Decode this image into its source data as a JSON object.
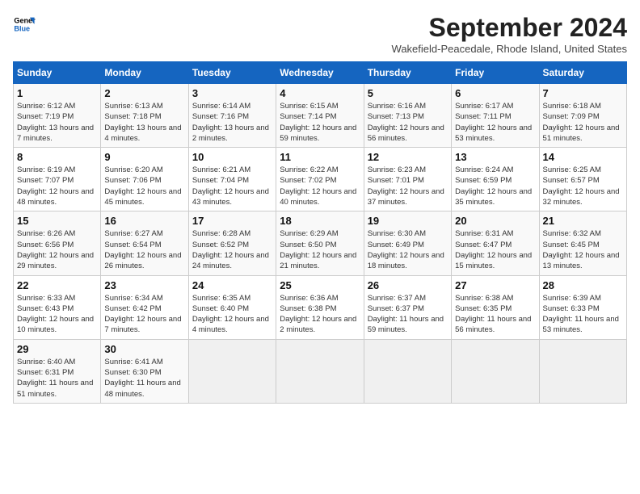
{
  "logo": {
    "line1": "General",
    "line2": "Blue"
  },
  "title": "September 2024",
  "subtitle": "Wakefield-Peacedale, Rhode Island, United States",
  "days_of_week": [
    "Sunday",
    "Monday",
    "Tuesday",
    "Wednesday",
    "Thursday",
    "Friday",
    "Saturday"
  ],
  "weeks": [
    [
      {
        "day": "1",
        "info": "Sunrise: 6:12 AM\nSunset: 7:19 PM\nDaylight: 13 hours\nand 7 minutes."
      },
      {
        "day": "2",
        "info": "Sunrise: 6:13 AM\nSunset: 7:18 PM\nDaylight: 13 hours\nand 4 minutes."
      },
      {
        "day": "3",
        "info": "Sunrise: 6:14 AM\nSunset: 7:16 PM\nDaylight: 13 hours\nand 2 minutes."
      },
      {
        "day": "4",
        "info": "Sunrise: 6:15 AM\nSunset: 7:14 PM\nDaylight: 12 hours\nand 59 minutes."
      },
      {
        "day": "5",
        "info": "Sunrise: 6:16 AM\nSunset: 7:13 PM\nDaylight: 12 hours\nand 56 minutes."
      },
      {
        "day": "6",
        "info": "Sunrise: 6:17 AM\nSunset: 7:11 PM\nDaylight: 12 hours\nand 53 minutes."
      },
      {
        "day": "7",
        "info": "Sunrise: 6:18 AM\nSunset: 7:09 PM\nDaylight: 12 hours\nand 51 minutes."
      }
    ],
    [
      {
        "day": "8",
        "info": "Sunrise: 6:19 AM\nSunset: 7:07 PM\nDaylight: 12 hours\nand 48 minutes."
      },
      {
        "day": "9",
        "info": "Sunrise: 6:20 AM\nSunset: 7:06 PM\nDaylight: 12 hours\nand 45 minutes."
      },
      {
        "day": "10",
        "info": "Sunrise: 6:21 AM\nSunset: 7:04 PM\nDaylight: 12 hours\nand 43 minutes."
      },
      {
        "day": "11",
        "info": "Sunrise: 6:22 AM\nSunset: 7:02 PM\nDaylight: 12 hours\nand 40 minutes."
      },
      {
        "day": "12",
        "info": "Sunrise: 6:23 AM\nSunset: 7:01 PM\nDaylight: 12 hours\nand 37 minutes."
      },
      {
        "day": "13",
        "info": "Sunrise: 6:24 AM\nSunset: 6:59 PM\nDaylight: 12 hours\nand 35 minutes."
      },
      {
        "day": "14",
        "info": "Sunrise: 6:25 AM\nSunset: 6:57 PM\nDaylight: 12 hours\nand 32 minutes."
      }
    ],
    [
      {
        "day": "15",
        "info": "Sunrise: 6:26 AM\nSunset: 6:56 PM\nDaylight: 12 hours\nand 29 minutes."
      },
      {
        "day": "16",
        "info": "Sunrise: 6:27 AM\nSunset: 6:54 PM\nDaylight: 12 hours\nand 26 minutes."
      },
      {
        "day": "17",
        "info": "Sunrise: 6:28 AM\nSunset: 6:52 PM\nDaylight: 12 hours\nand 24 minutes."
      },
      {
        "day": "18",
        "info": "Sunrise: 6:29 AM\nSunset: 6:50 PM\nDaylight: 12 hours\nand 21 minutes."
      },
      {
        "day": "19",
        "info": "Sunrise: 6:30 AM\nSunset: 6:49 PM\nDaylight: 12 hours\nand 18 minutes."
      },
      {
        "day": "20",
        "info": "Sunrise: 6:31 AM\nSunset: 6:47 PM\nDaylight: 12 hours\nand 15 minutes."
      },
      {
        "day": "21",
        "info": "Sunrise: 6:32 AM\nSunset: 6:45 PM\nDaylight: 12 hours\nand 13 minutes."
      }
    ],
    [
      {
        "day": "22",
        "info": "Sunrise: 6:33 AM\nSunset: 6:43 PM\nDaylight: 12 hours\nand 10 minutes."
      },
      {
        "day": "23",
        "info": "Sunrise: 6:34 AM\nSunset: 6:42 PM\nDaylight: 12 hours\nand 7 minutes."
      },
      {
        "day": "24",
        "info": "Sunrise: 6:35 AM\nSunset: 6:40 PM\nDaylight: 12 hours\nand 4 minutes."
      },
      {
        "day": "25",
        "info": "Sunrise: 6:36 AM\nSunset: 6:38 PM\nDaylight: 12 hours\nand 2 minutes."
      },
      {
        "day": "26",
        "info": "Sunrise: 6:37 AM\nSunset: 6:37 PM\nDaylight: 11 hours\nand 59 minutes."
      },
      {
        "day": "27",
        "info": "Sunrise: 6:38 AM\nSunset: 6:35 PM\nDaylight: 11 hours\nand 56 minutes."
      },
      {
        "day": "28",
        "info": "Sunrise: 6:39 AM\nSunset: 6:33 PM\nDaylight: 11 hours\nand 53 minutes."
      }
    ],
    [
      {
        "day": "29",
        "info": "Sunrise: 6:40 AM\nSunset: 6:31 PM\nDaylight: 11 hours\nand 51 minutes."
      },
      {
        "day": "30",
        "info": "Sunrise: 6:41 AM\nSunset: 6:30 PM\nDaylight: 11 hours\nand 48 minutes."
      },
      {
        "day": "",
        "info": ""
      },
      {
        "day": "",
        "info": ""
      },
      {
        "day": "",
        "info": ""
      },
      {
        "day": "",
        "info": ""
      },
      {
        "day": "",
        "info": ""
      }
    ]
  ]
}
